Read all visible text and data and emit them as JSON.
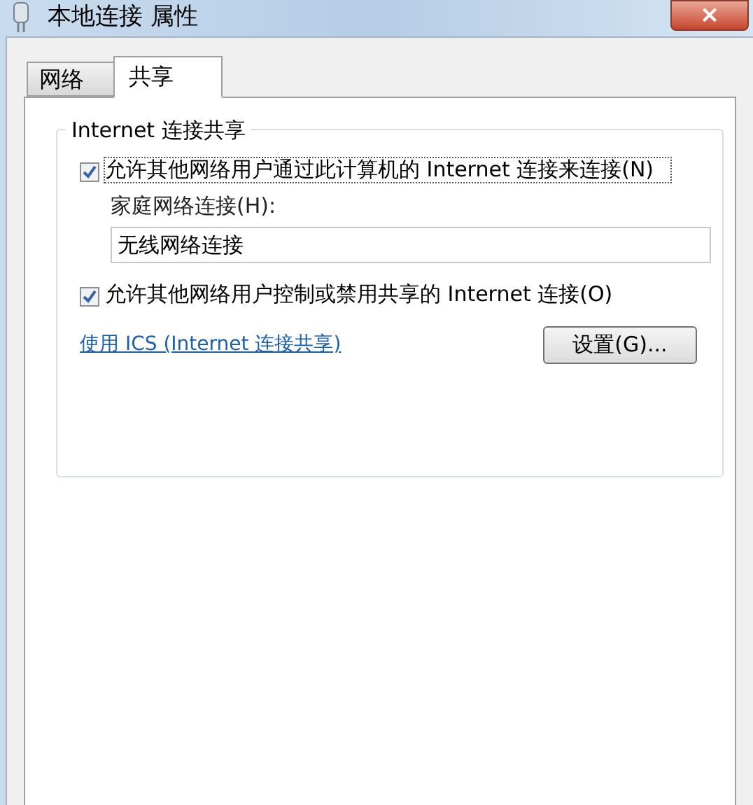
{
  "window": {
    "title": "本地连接 属性",
    "close": "×"
  },
  "tabs": [
    {
      "label": "网络",
      "selected": false
    },
    {
      "label": "共享",
      "selected": true
    }
  ],
  "group": {
    "title": "Internet 连接共享",
    "options": [
      {
        "label": "允许其他网络用户通过此计算机的 Internet 连接来连接(N)",
        "checked": true,
        "focused": true
      },
      {
        "label": "允许其他网络用户控制或禁用共享的 Internet 连接(O)",
        "checked": true,
        "focused": false
      }
    ],
    "home_label": "家庭网络连接(H):",
    "home_value": "无线网络连接",
    "link": "使用 ICS (Internet 连接共享)",
    "settings_button": "设置(G)..."
  }
}
